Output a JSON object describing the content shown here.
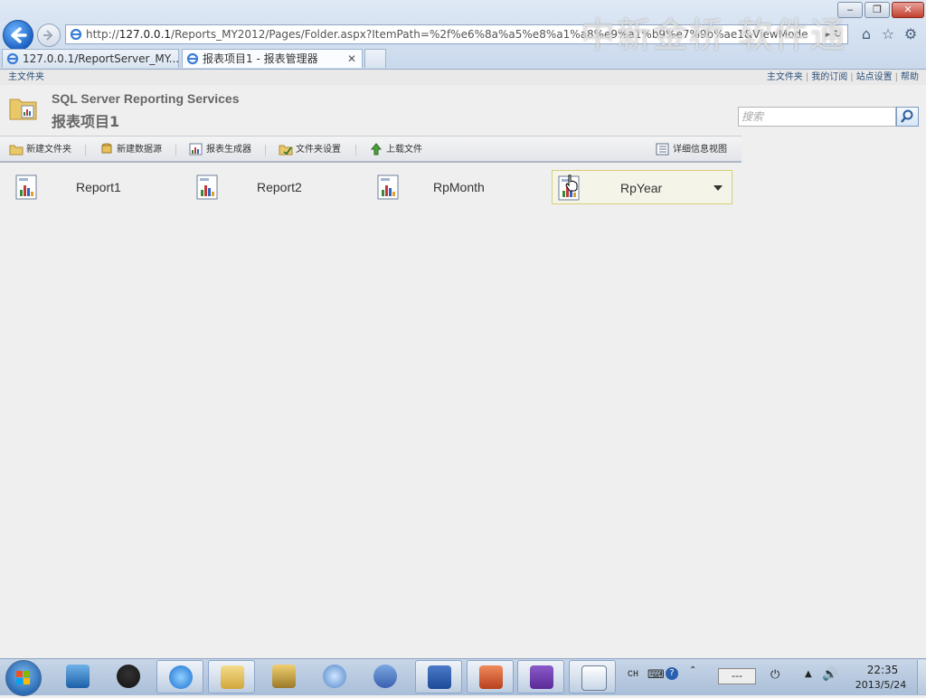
{
  "browser": {
    "address_url_prefix": "http://",
    "address_url_host": "127.0.0.1",
    "address_url_rest": "/Reports_MY2012/Pages/Folder.aspx?ItemPath=%2f%e6%8a%a5%e8%a1%a8%e9%a1%b9%e7%9b%ae1&ViewMode",
    "address_icons": "▸ ↻",
    "watermark": "中新金桥  软件通",
    "window_buttons": {
      "minimize": "‒",
      "maximize": "❐",
      "close": "✕"
    },
    "tabs": [
      {
        "label": "127.0.0.1/ReportServer_MY..."
      },
      {
        "label": "报表项目1 - 报表管理器",
        "close": "✕"
      }
    ]
  },
  "page": {
    "breadcrumb_home": "主文件夹",
    "site_links": [
      "主文件夹",
      "我的订阅",
      "站点设置",
      "帮助"
    ],
    "product_name": "SQL Server Reporting Services",
    "folder_title": "报表项目1",
    "search_placeholder": "搜索",
    "toolbar": {
      "new_folder": "新建文件夹",
      "new_datasource": "新建数据源",
      "report_builder": "报表生成器",
      "folder_settings": "文件夹设置",
      "upload_file": "上载文件",
      "details_view": "详细信息视图"
    },
    "items": [
      {
        "name": "Report1"
      },
      {
        "name": "Report2"
      },
      {
        "name": "RpMonth"
      },
      {
        "name": "RpYear"
      }
    ]
  },
  "taskbar": {
    "tray_lang": "CH",
    "tray_status_value": "---",
    "clock_time": "22:35",
    "clock_date": "2013/5/24"
  },
  "colors": {
    "accent_link": "#2a4f7a",
    "hover_border": "#d8cf78",
    "chrome_bg": "#c9d9ec",
    "page_bg": "#efefef"
  }
}
